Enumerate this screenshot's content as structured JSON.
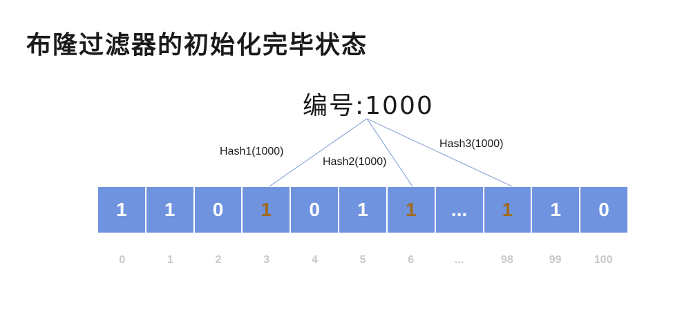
{
  "title": "布隆过滤器的初始化完毕状态",
  "element": {
    "label": "编号:1000"
  },
  "hash_functions": [
    {
      "label": "Hash1(1000)",
      "target_index": "3"
    },
    {
      "label": "Hash2(1000)",
      "target_index": "6"
    },
    {
      "label": "Hash3(1000)",
      "target_index": "98"
    }
  ],
  "bit_array": {
    "values": [
      "1",
      "1",
      "0",
      "1",
      "0",
      "1",
      "1",
      "...",
      "1",
      "1",
      "0"
    ],
    "indices": [
      "0",
      "1",
      "2",
      "3",
      "4",
      "5",
      "6",
      "...",
      "98",
      "99",
      "100"
    ],
    "highlighted_positions": [
      3,
      6,
      8
    ]
  },
  "colors": {
    "cell_fill": "#6f93df",
    "bit_text": "#ffffff",
    "hit_bit_text": "#a06a1c",
    "index_text": "#c8c8c8",
    "connector_line": "#8fa8d6"
  }
}
